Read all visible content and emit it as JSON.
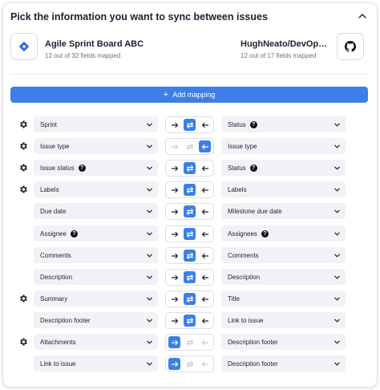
{
  "title": "Pick the information you want to sync between issues",
  "source": {
    "name": "Agile Sprint Board ABC",
    "fields_mapped": "12 out of 32 fields mapped"
  },
  "target": {
    "name": "HughNeato/DevOps-Ini...",
    "fields_mapped": "12 out of 17 fields mapped"
  },
  "add_mapping_label": "Add mapping",
  "colors": {
    "accent": "#3d7fe6",
    "field_bg": "#f1f2f5",
    "icon_dim": "#c9ccd3"
  },
  "mappings": [
    {
      "left": "Sprint",
      "left_help": "",
      "right": "Status",
      "right_help": "?",
      "gear": true,
      "direction": "both"
    },
    {
      "left": "Issue type",
      "left_help": "",
      "right": "Issue type",
      "right_help": "",
      "gear": true,
      "direction": "to-left"
    },
    {
      "left": "Issue status",
      "left_help": "?",
      "right": "Status",
      "right_help": "?",
      "gear": true,
      "direction": "both"
    },
    {
      "left": "Labels",
      "left_help": "",
      "right": "Labels",
      "right_help": "",
      "gear": true,
      "direction": "both"
    },
    {
      "left": "Due date",
      "left_help": "",
      "right": "Milestone due date",
      "right_help": "",
      "gear": false,
      "direction": "both"
    },
    {
      "left": "Assignee",
      "left_help": "?",
      "right": "Assignees",
      "right_help": "?",
      "gear": false,
      "direction": "both"
    },
    {
      "left": "Comments",
      "left_help": "",
      "right": "Comments",
      "right_help": "",
      "gear": false,
      "direction": "both"
    },
    {
      "left": "Description",
      "left_help": "",
      "right": "Description",
      "right_help": "",
      "gear": false,
      "direction": "both"
    },
    {
      "left": "Summary",
      "left_help": "",
      "right": "Title",
      "right_help": "",
      "gear": true,
      "direction": "both"
    },
    {
      "left": "Description footer",
      "left_help": "",
      "right": "Link to issue",
      "right_help": "",
      "gear": false,
      "direction": "both"
    },
    {
      "left": "Attachments",
      "left_help": "",
      "right": "Description footer",
      "right_help": "",
      "gear": true,
      "direction": "to-right"
    },
    {
      "left": "Link to issue",
      "left_help": "",
      "right": "Description footer",
      "right_help": "",
      "gear": false,
      "direction": "to-right"
    }
  ]
}
